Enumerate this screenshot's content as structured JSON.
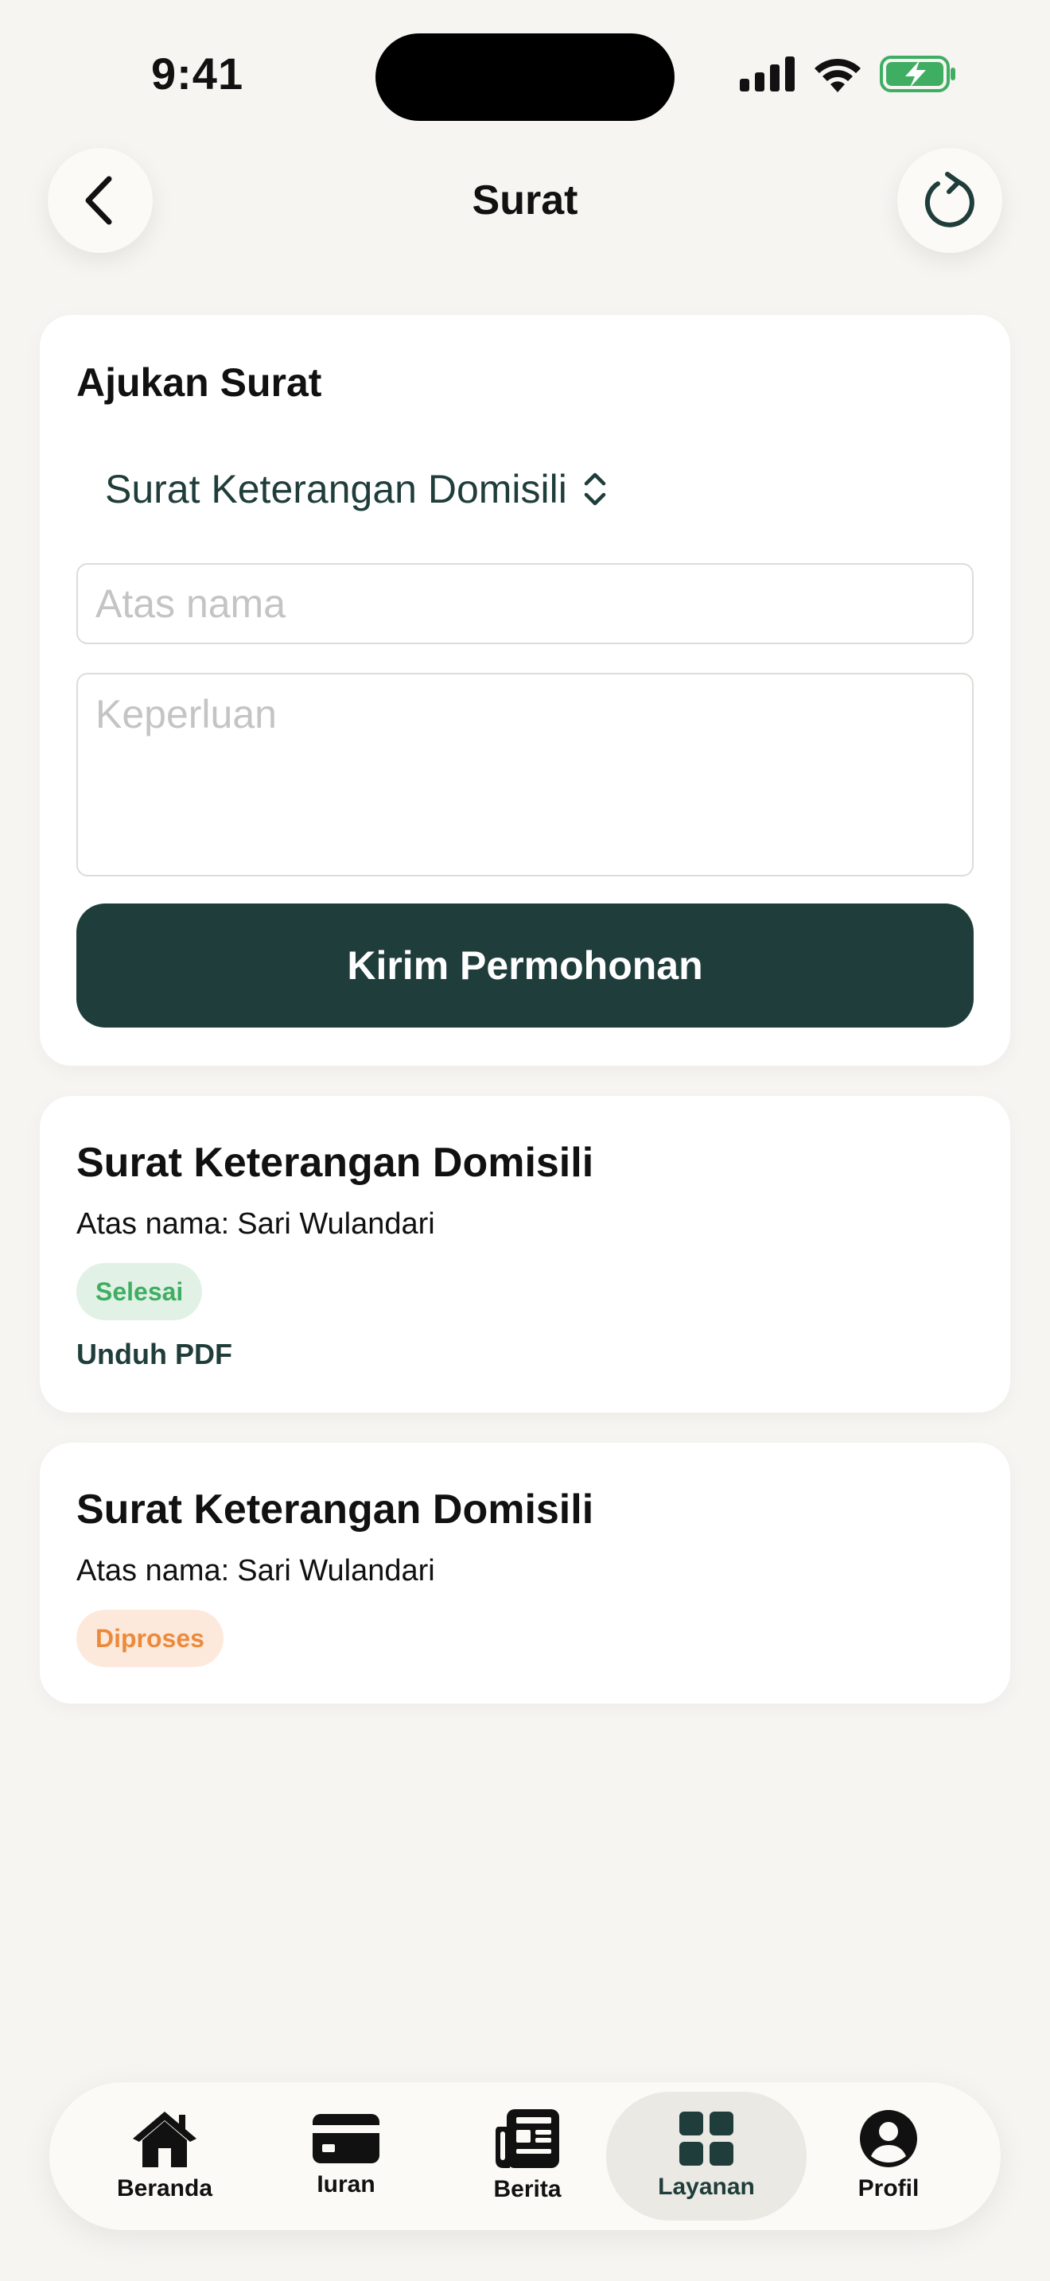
{
  "status_bar": {
    "time": "9:41"
  },
  "header": {
    "title": "Surat"
  },
  "form": {
    "heading": "Ajukan Surat",
    "letter_type": "Surat Keterangan Domisili",
    "name_placeholder": "Atas nama",
    "purpose_placeholder": "Keperluan",
    "submit_label": "Kirim Permohonan"
  },
  "requests": [
    {
      "title": "Surat Keterangan Domisili",
      "owner_label": "Atas nama:",
      "owner_name": "Sari Wulandari",
      "status": "Selesai",
      "download_label": "Unduh PDF"
    },
    {
      "title": "Surat Keterangan Domisili",
      "owner_label": "Atas nama:",
      "owner_name": "Sari Wulandari",
      "status": "Diproses"
    }
  ],
  "tabs": [
    {
      "label": "Beranda",
      "icon": "home-icon"
    },
    {
      "label": "Iuran",
      "icon": "card-icon"
    },
    {
      "label": "Berita",
      "icon": "newspaper-icon"
    },
    {
      "label": "Layanan",
      "icon": "grid-icon",
      "active": true
    },
    {
      "label": "Profil",
      "icon": "person-icon"
    }
  ],
  "colors": {
    "primary": "#1f3d3a",
    "background": "#f6f5f2",
    "status_done_text": "#3fae63",
    "status_done_bg": "#e2f1e6",
    "status_process_text": "#ec8a3c",
    "status_process_bg": "#fde9db"
  }
}
